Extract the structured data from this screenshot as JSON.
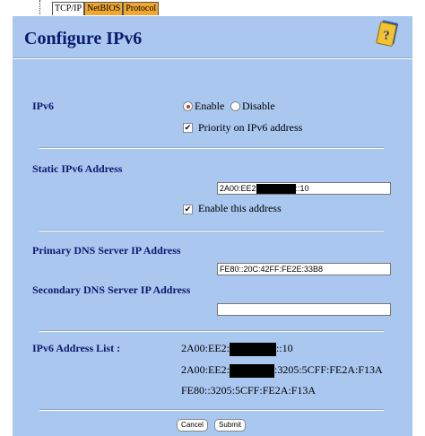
{
  "tabs": [
    {
      "label": "TCP/IP",
      "active": true
    },
    {
      "label": "NetBIOS",
      "active": false
    },
    {
      "label": "Protocol",
      "active": false
    }
  ],
  "page_title": "Configure IPv6",
  "help_icon": "question-book-icon",
  "ipv6": {
    "label": "IPv6",
    "enable_label": "Enable",
    "disable_label": "Disable",
    "selected": "Enable",
    "priority_label": "Priority on IPv6 address",
    "priority_checked": true
  },
  "static": {
    "label": "Static IPv6 Address",
    "value_prefix": "2A00:EE2",
    "value_suffix": "::10",
    "enable_label": "Enable this address",
    "enable_checked": true
  },
  "primary_dns": {
    "label": "Primary DNS Server IP Address",
    "value": "FE80::20C:42FF:FE2E:33B8"
  },
  "secondary_dns": {
    "label": "Secondary DNS Server IP Address",
    "value": ""
  },
  "address_list": {
    "label": "IPv6 Address List :",
    "items": [
      {
        "prefix": "2A00:EE2:",
        "suffix": "::10"
      },
      {
        "prefix": "2A00:EE2:",
        "suffix": ":3205:5CFF:FE2A:F13A"
      },
      {
        "prefix": "FE80::3205:5CFF:FE2A:F13A",
        "suffix": ""
      }
    ]
  },
  "buttons": {
    "cancel": "Cancel",
    "submit": "Submit"
  },
  "colors": {
    "panel_bg": "#aac7f0",
    "title": "#0a1a6e",
    "tab_inactive": "#f0a830",
    "radio_selected": "#c0392b"
  }
}
